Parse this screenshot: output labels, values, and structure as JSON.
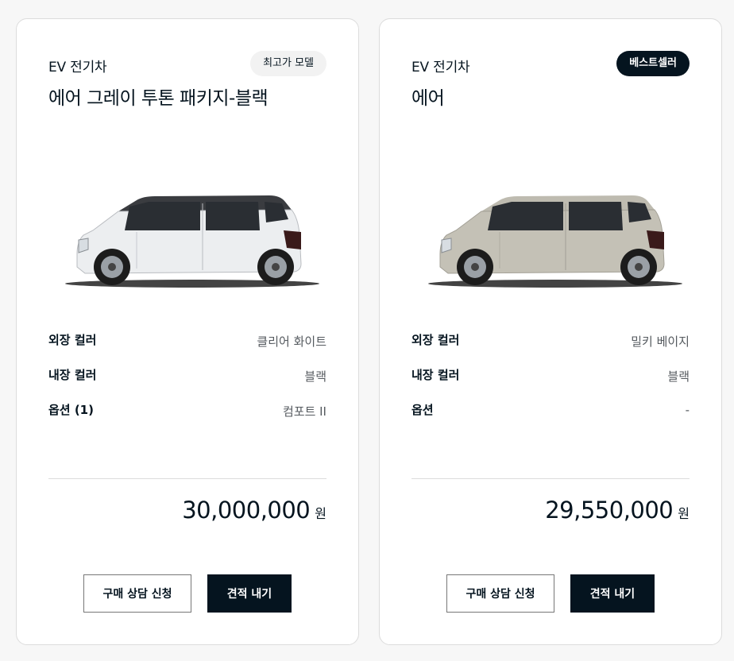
{
  "cards": [
    {
      "category": "EV 전기차",
      "badge": "최고가 모델",
      "badge_style": "light",
      "name": "에어 그레이 투톤 패키지-블랙",
      "car_body_color": "#eceef0",
      "car_roof_color": "#3a3c40",
      "specs": [
        {
          "label": "외장 컬러",
          "value": "클리어 화이트"
        },
        {
          "label": "내장 컬러",
          "value": "블랙"
        },
        {
          "label": "옵션 (1)",
          "value": "컴포트 II"
        }
      ],
      "price": "30,000,000",
      "price_unit": "원",
      "consult_label": "구매 상담 신청",
      "quote_label": "견적 내기"
    },
    {
      "category": "EV 전기차",
      "badge": "베스트셀러",
      "badge_style": "dark",
      "name": "에어",
      "car_body_color": "#c4c1b6",
      "car_roof_color": "#bebbb0",
      "specs": [
        {
          "label": "외장 컬러",
          "value": "밀키 베이지"
        },
        {
          "label": "내장 컬러",
          "value": "블랙"
        },
        {
          "label": "옵션",
          "value": "-"
        }
      ],
      "price": "29,550,000",
      "price_unit": "원",
      "consult_label": "구매 상담 신청",
      "quote_label": "견적 내기"
    }
  ],
  "colors": {
    "primary": "#05141f",
    "badge_light": "#f2f2f2",
    "divider": "#dcdcdc"
  }
}
